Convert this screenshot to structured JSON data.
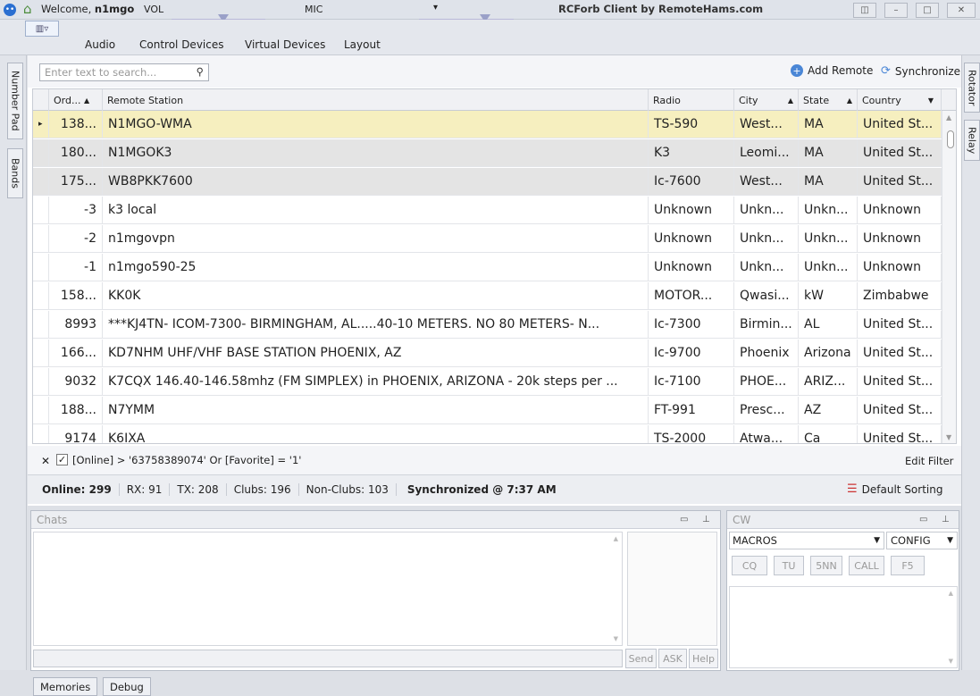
{
  "window": {
    "welcome_prefix": "Welcome,",
    "user": "n1mgo",
    "vol_label": "VOL",
    "vol_level": 0.55,
    "mic_label": "MIC",
    "mic_level": 0.7,
    "title": "RCForb Client by RemoteHams.com"
  },
  "menu": {
    "tabs": [
      "Audio",
      "Control Devices",
      "Virtual Devices",
      "Layout"
    ]
  },
  "sidebar_left": [
    "Number Pad",
    "Bands"
  ],
  "sidebar_right": [
    "Rotator",
    "Relay"
  ],
  "toolbar": {
    "search_placeholder": "Enter text to search...",
    "add_remote": "Add Remote",
    "synchronize": "Synchronize"
  },
  "grid": {
    "columns": [
      "Ord...",
      "Remote Station",
      "Radio",
      "City",
      "State",
      "Country"
    ],
    "rows": [
      [
        "138...",
        "N1MGO-WMA",
        "TS-590",
        "West...",
        "MA",
        "United St..."
      ],
      [
        "180...",
        "N1MGOK3",
        "K3",
        "Leomi...",
        "MA",
        "United St..."
      ],
      [
        "175...",
        "WB8PKK7600",
        "Ic-7600",
        "West...",
        "MA",
        "United St..."
      ],
      [
        "-3",
        "k3 local",
        "Unknown",
        "Unkn...",
        "Unkn...",
        "Unknown"
      ],
      [
        "-2",
        "n1mgovpn",
        "Unknown",
        "Unkn...",
        "Unkn...",
        "Unknown"
      ],
      [
        "-1",
        "n1mgo590-25",
        "Unknown",
        "Unkn...",
        "Unkn...",
        "Unknown"
      ],
      [
        "158...",
        "KK0K",
        "MOTOR...",
        "Qwasi...",
        "kW",
        "Zimbabwe"
      ],
      [
        "8993",
        "***KJ4TN- ICOM-7300- BIRMINGHAM, AL.....40-10 METERS. NO 80 METERS- N...",
        "Ic-7300",
        "Birmin...",
        "AL",
        "United St..."
      ],
      [
        "166...",
        "KD7NHM UHF/VHF BASE STATION PHOENIX, AZ",
        "Ic-9700",
        "Phoenix",
        "Arizona",
        "United St..."
      ],
      [
        "9032",
        "K7CQX 146.40-146.58mhz (FM SIMPLEX) in PHOENIX, ARIZONA - 20k steps per ...",
        "Ic-7100",
        "PHOE...",
        "ARIZ...",
        "United St..."
      ],
      [
        "188...",
        "N7YMM",
        "FT-991",
        "Presc...",
        "AZ",
        "United St..."
      ],
      [
        "9174",
        "K6IXA",
        "TS-2000",
        "Atwa...",
        "Ca",
        "United St..."
      ]
    ]
  },
  "filter": {
    "expression": "[Online] > '63758389074' Or [Favorite] = '1'",
    "edit": "Edit Filter"
  },
  "status": {
    "online": "Online: 299",
    "rx": "RX: 91",
    "tx": "TX: 208",
    "clubs": "Clubs: 196",
    "nonclubs": "Non-Clubs: 103",
    "sync": "Synchronized @ 7:37 AM",
    "sorting": "Default Sorting"
  },
  "chats": {
    "title": "Chats",
    "send": "Send",
    "ask": "ASK",
    "help": "Help"
  },
  "cw": {
    "title": "CW",
    "macros": "MACROS",
    "config": "CONFIG",
    "keys": [
      "CQ",
      "TU",
      "5NN",
      "CALL",
      "F5"
    ]
  },
  "bottom_tabs": [
    "Memories",
    "Debug"
  ],
  "colors": {
    "selected_row": "#f6efbf",
    "highlight_row": "#e4e4e4",
    "annotation": "#e0303a"
  }
}
